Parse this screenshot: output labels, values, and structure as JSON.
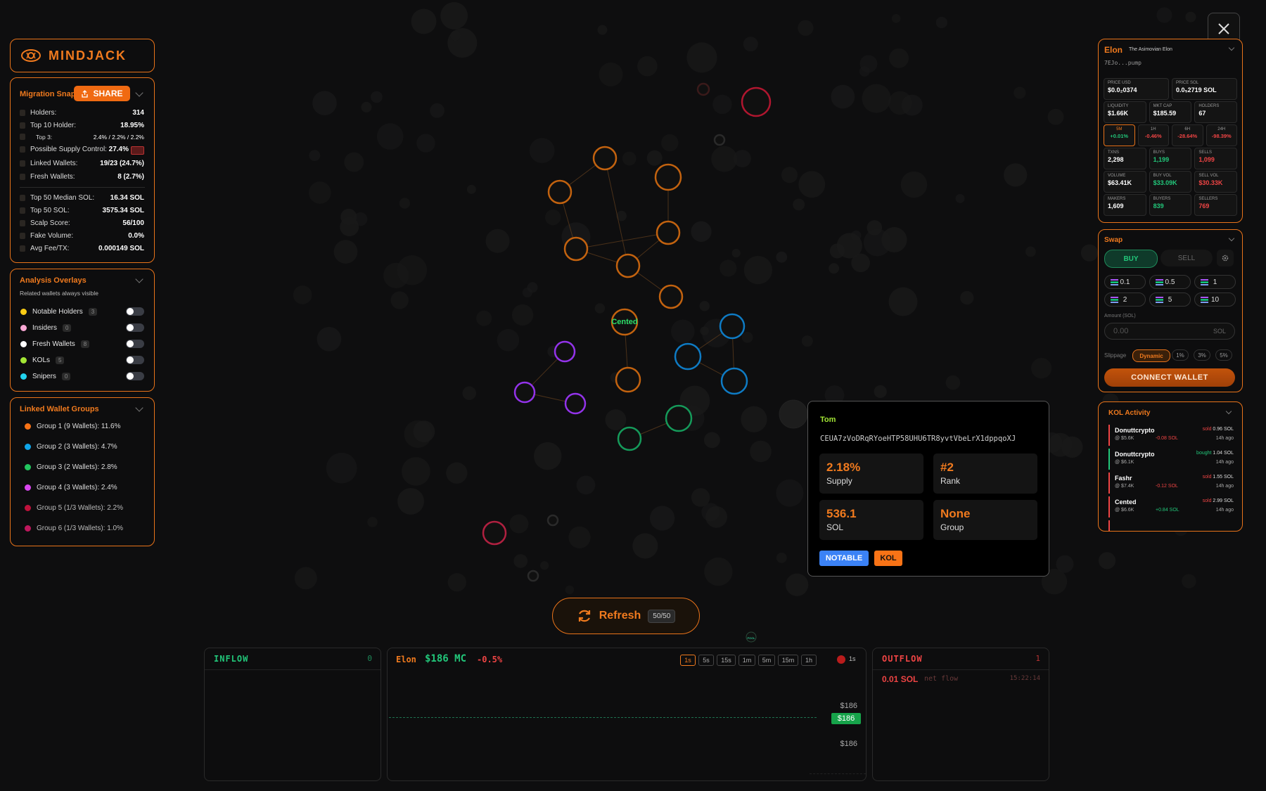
{
  "brand": {
    "name": "MINDJACK"
  },
  "migration": {
    "title": "Migration Snap",
    "share_label": "SHARE",
    "rows": [
      {
        "label": "Holders:",
        "value": "314"
      },
      {
        "label": "Top 10 Holder:",
        "value": "18.95%"
      },
      {
        "label": "Top 3:",
        "value": "2.4% / 2.2% / 2.2%"
      },
      {
        "label": "Possible Supply Control:",
        "value": "27.4%"
      },
      {
        "label": "Linked Wallets:",
        "value": "19/23 (24.7%)"
      },
      {
        "label": "Fresh Wallets:",
        "value": "8 (2.7%)"
      },
      {
        "label": "Top 50 Median SOL:",
        "value": "16.34 SOL"
      },
      {
        "label": "Top 50 SOL:",
        "value": "3575.34 SOL"
      },
      {
        "label": "Scalp Score:",
        "value": "56/100"
      },
      {
        "label": "Fake Volume:",
        "value": "0.0%"
      },
      {
        "label": "Avg Fee/TX:",
        "value": "0.000149 SOL"
      }
    ]
  },
  "overlays": {
    "title": "Analysis Overlays",
    "subtitle": "Related wallets always visible",
    "items": [
      {
        "label": "Notable Holders",
        "count": "3",
        "color": "#facc15"
      },
      {
        "label": "Insiders",
        "count": "0",
        "color": "#f9a8d4"
      },
      {
        "label": "Fresh Wallets",
        "count": "8",
        "color": "#ffffff"
      },
      {
        "label": "KOLs",
        "count": "5",
        "color": "#a3e635"
      },
      {
        "label": "Snipers",
        "count": "0",
        "color": "#22d3ee"
      }
    ]
  },
  "groups": {
    "title": "Linked Wallet Groups",
    "items": [
      {
        "label": "Group 1 (9 Wallets): 11.6%",
        "color": "#f97316"
      },
      {
        "label": "Group 2 (3 Wallets): 4.7%",
        "color": "#0ea5e9"
      },
      {
        "label": "Group 3 (2 Wallets): 2.8%",
        "color": "#22c55e"
      },
      {
        "label": "Group 4 (3 Wallets): 2.4%",
        "color": "#d946ef"
      },
      {
        "label": "Group 5 (1/3 Wallets): 2.2%",
        "color": "#be123c"
      },
      {
        "label": "Group 6 (1/3 Wallets): 1.0%",
        "color": "#be185d"
      }
    ]
  },
  "graph": {
    "center_label": "Cented",
    "pool_label": "POOL"
  },
  "tooltip": {
    "name": "Tom",
    "address": "CEUA7zVoDRqRYoeHTP58UHU6TR8yvtVbeLrX1dppqoXJ",
    "supply_value": "2.18%",
    "supply_label": "Supply",
    "rank_value": "#2",
    "rank_label": "Rank",
    "sol_value": "536.1",
    "sol_label": "SOL",
    "group_value": "None",
    "group_label": "Group",
    "tags": [
      "NOTABLE",
      "KOL"
    ]
  },
  "refresh": {
    "label": "Refresh",
    "count": "50/50"
  },
  "inflow": {
    "title": "INFLOW",
    "count": "0"
  },
  "chart": {
    "token": "Elon",
    "mc": "$186 MC",
    "change": "-0.5%",
    "timeframes": [
      "1s",
      "5s",
      "15s",
      "1m",
      "5m",
      "15m",
      "1h"
    ],
    "live_label": "1s",
    "price_top": "$186",
    "price_current": "$186",
    "price_bottom": "$186"
  },
  "outflow": {
    "title": "OUTFLOW",
    "count": "1",
    "amount": "0.01 SOL",
    "label": "net flow",
    "time": "15:22:14"
  },
  "token": {
    "name": "Elon",
    "subtitle": "The Asimovian Elon",
    "address": "7EJo...pump",
    "cells": [
      {
        "label": "PRICE USD",
        "value": "$0.0₂0374"
      },
      {
        "label": "PRICE SOL",
        "value": "0.0₅2719 SOL"
      },
      {
        "label": "LIQUIDITY",
        "value": "$1.66K"
      },
      {
        "label": "MKT CAP",
        "value": "$185.59"
      },
      {
        "label": "HOLDERS",
        "value": "67"
      },
      {
        "label": "5M",
        "value": "+0.01%"
      },
      {
        "label": "1H",
        "value": "-0.46%"
      },
      {
        "label": "6H",
        "value": "-28.64%"
      },
      {
        "label": "24H",
        "value": "-98.39%"
      },
      {
        "label": "TXNS",
        "value": "2,298"
      },
      {
        "label": "BUYS",
        "value": "1,199"
      },
      {
        "label": "SELLS",
        "value": "1,099"
      },
      {
        "label": "VOLUME",
        "value": "$63.41K"
      },
      {
        "label": "BUY VOL",
        "value": "$33.09K"
      },
      {
        "label": "SELL VOL",
        "value": "$30.33K"
      },
      {
        "label": "MAKERS",
        "value": "1,609"
      },
      {
        "label": "BUYERS",
        "value": "839"
      },
      {
        "label": "SELLERS",
        "value": "769"
      }
    ]
  },
  "swap": {
    "title": "Swap",
    "buy_label": "BUY",
    "sell_label": "SELL",
    "amounts": [
      "0.1",
      "0.5",
      "1",
      "2",
      "5",
      "10"
    ],
    "amount_label": "Amount (SOL)",
    "amount_placeholder": "0.00",
    "amount_unit": "SOL",
    "slippage_label": "Slippage",
    "slippage_options": [
      "Dynamic",
      "1%",
      "3%",
      "5%"
    ],
    "connect_label": "CONNECT WALLET"
  },
  "kol": {
    "title": "KOL Activity",
    "items": [
      {
        "name": "Donuttcrypto",
        "mc": "@ $5.6K",
        "action": "sold",
        "amount": "0.96 SOL",
        "delta": "-0.08 SOL",
        "time": "14h ago"
      },
      {
        "name": "Donuttcrypto",
        "mc": "@ $6.1K",
        "action": "bought",
        "amount": "1.04 SOL",
        "delta": "",
        "time": "14h ago"
      },
      {
        "name": "Fashr",
        "mc": "@ $7.4K",
        "action": "sold",
        "amount": "1.55 SOL",
        "delta": "-0.12 SOL",
        "time": "14h ago"
      },
      {
        "name": "Cented",
        "mc": "@ $6.6K",
        "action": "sold",
        "amount": "2.99 SOL",
        "delta": "+0.84 SOL",
        "time": "14h ago"
      }
    ]
  }
}
